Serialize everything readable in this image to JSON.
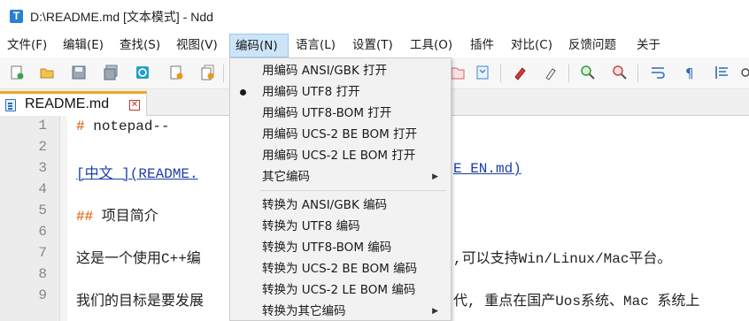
{
  "window": {
    "title": "D:\\README.md [文本模式] - Ndd",
    "app_icon_letter": "T"
  },
  "menubar": [
    {
      "label": "文件(F)"
    },
    {
      "label": "编辑(E)"
    },
    {
      "label": "查找(S)"
    },
    {
      "label": "视图(V)"
    },
    {
      "label": "编码(N)"
    },
    {
      "label": "语言(L)"
    },
    {
      "label": "设置(T)"
    },
    {
      "label": "工具(O)"
    },
    {
      "label": "插件"
    },
    {
      "label": "对比(C)"
    },
    {
      "label": "反馈问题"
    },
    {
      "label": "关于"
    }
  ],
  "toolbar_icons": [
    "new-file",
    "open-file",
    "save",
    "save-all",
    "reload",
    "close-file",
    "close-all",
    "copy",
    "bookmark",
    "clear",
    "eraser",
    "zoom-in",
    "zoom-out",
    "wrap",
    "show-all-chars",
    "indent-guide"
  ],
  "tab": {
    "label": "README.md",
    "close_symbol": "⊠"
  },
  "editor": {
    "line_numbers": [
      "1",
      "2",
      "3",
      "4",
      "5",
      "6",
      "7",
      "8",
      "9"
    ],
    "lines": [
      {
        "hash": "#",
        "text": " notepad--"
      },
      {
        "text": ""
      },
      {
        "link_left": "[中文 ](README.",
        "link_right": "E_EN.md)"
      },
      {
        "text": ""
      },
      {
        "hash": "##",
        "text": " 项目简介"
      },
      {
        "text": ""
      },
      {
        "left": "这是一个使用C++编",
        "right": ",可以支持Win/Linux/Mac平台。"
      },
      {
        "text": ""
      },
      {
        "left": "我们的目标是要发展",
        "right": "代, 重点在国产Uos系统、Mac 系统上"
      }
    ]
  },
  "encoding_menu": {
    "items": [
      {
        "label": "用编码 ANSI/GBK 打开",
        "checked": false,
        "submenu": false
      },
      {
        "label": "用编码 UTF8 打开",
        "checked": true,
        "submenu": false
      },
      {
        "label": "用编码 UTF8-BOM 打开",
        "checked": false,
        "submenu": false
      },
      {
        "label": "用编码 UCS-2 BE BOM 打开",
        "checked": false,
        "submenu": false
      },
      {
        "label": "用编码 UCS-2 LE BOM 打开",
        "checked": false,
        "submenu": false
      },
      {
        "label": "其它编码",
        "checked": false,
        "submenu": true
      },
      {
        "label": "转换为 ANSI/GBK 编码",
        "checked": false,
        "submenu": false
      },
      {
        "label": "转换为 UTF8 编码",
        "checked": false,
        "submenu": false
      },
      {
        "label": "转换为 UTF8-BOM 编码",
        "checked": false,
        "submenu": false
      },
      {
        "label": "转换为 UCS-2 BE BOM 编码",
        "checked": false,
        "submenu": false
      },
      {
        "label": "转换为 UCS-2 LE BOM 编码",
        "checked": false,
        "submenu": false
      },
      {
        "label": "转换为其它编码",
        "checked": false,
        "submenu": true
      }
    ],
    "submenu_arrow": "▶"
  },
  "colors": {
    "active_menu_bg": "#cce4f7",
    "tab_accent": "#f4a21e",
    "md_heading": "#e07a2a",
    "md_link": "#1c3fa8"
  }
}
